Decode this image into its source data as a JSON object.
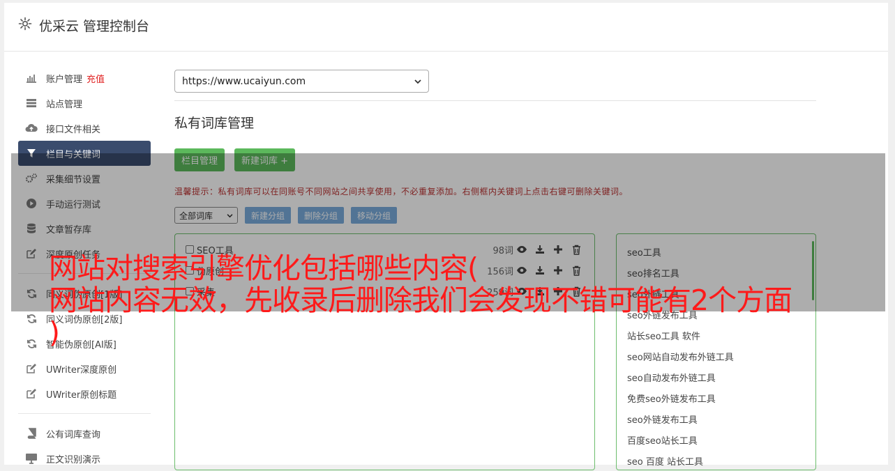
{
  "header": {
    "title": "优采云 管理控制台",
    "icon": "gear-icon"
  },
  "sidebar": {
    "items": [
      {
        "label": "账户管理",
        "extra": "充值",
        "icon": "bar-chart-icon"
      },
      {
        "label": "站点管理",
        "icon": "server-icon"
      },
      {
        "label": "接口文件相关",
        "icon": "cloud-upload-icon"
      },
      {
        "label": "栏目与关键词",
        "icon": "filter-icon",
        "active": true
      },
      {
        "label": "采集细节设置",
        "icon": "gears-icon"
      },
      {
        "label": "手动运行测试",
        "icon": "play-icon"
      },
      {
        "label": "文章暂存库",
        "icon": "database-icon"
      },
      {
        "label": "深度原创任务",
        "icon": "edit-icon"
      },
      {
        "label": "同义词伪原创[1版]",
        "icon": "refresh-icon"
      },
      {
        "label": "同义词伪原创[2版]",
        "icon": "refresh-icon"
      },
      {
        "label": "智能伪原创[AI版]",
        "icon": "refresh-icon"
      },
      {
        "label": "UWriter深度原创",
        "icon": "edit-icon"
      },
      {
        "label": "UWriter原创标题",
        "icon": "edit-icon"
      },
      {
        "label": "公有词库查询",
        "icon": "book-icon"
      },
      {
        "label": "正文识别演示",
        "icon": "monitor-icon"
      }
    ]
  },
  "main": {
    "site_select": "https://www.ucaiyun.com",
    "section_title": "私有词库管理",
    "buttons": {
      "column_manage": "栏目管理",
      "new_library": "新建词库 +"
    },
    "tip": "温馨提示：私有词库可以在同账号不同网站之间共享使用，不必重复添加。右侧框内关键词上点击右键可删除关键词。",
    "filter": {
      "library_select": "全部词库",
      "new_group": "新建分组",
      "delete_group": "删除分组",
      "move_group": "移动分组"
    },
    "libraries": [
      {
        "name": "SEO工具",
        "count": "98词"
      },
      {
        "name": "伪原创",
        "count": "156词"
      },
      {
        "name": "采集",
        "count": "259词"
      }
    ],
    "keywords": [
      "seo工具",
      "seo排名工具",
      "seo外链工具",
      "seo外链发布工具",
      "站长seo工具 软件",
      "seo网站自动发布外链工具",
      "seo自动发布外链工具",
      "免费seo外链发布工具",
      "seo外链发布工具",
      "百度seo站长工具",
      "seo 百度 站长工具"
    ]
  },
  "overlay": {
    "line1": "网站对搜索引擎优化包括哪些内容(",
    "line2": "网站内容无效，先收录后删除我们会发现不错可能有2个方面",
    "line3": ")"
  }
}
